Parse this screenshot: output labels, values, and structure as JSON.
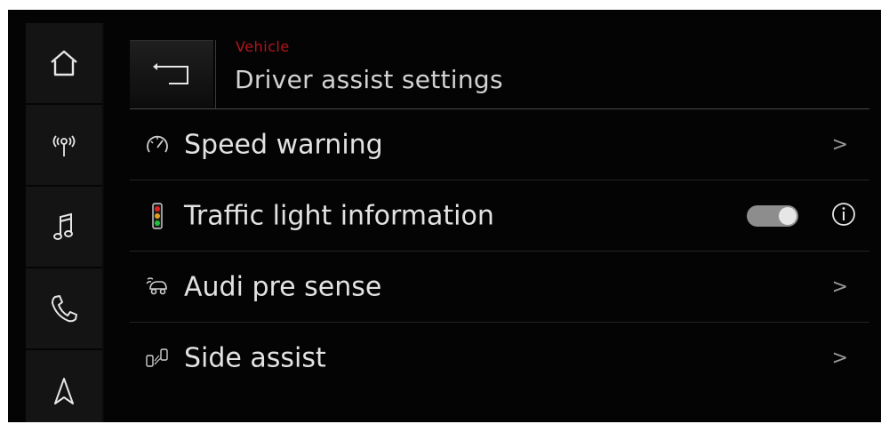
{
  "header": {
    "breadcrumb": "Vehicle",
    "title": "Driver assist settings"
  },
  "sidebar": {
    "items": [
      {
        "icon": "home-icon"
      },
      {
        "icon": "radio-icon"
      },
      {
        "icon": "music-icon"
      },
      {
        "icon": "phone-icon"
      },
      {
        "icon": "navigation-icon"
      }
    ]
  },
  "settings": {
    "items": [
      {
        "label": "Speed warning",
        "icon": "speedometer-icon",
        "control": "chevron",
        "chevron": ">"
      },
      {
        "label": "Traffic light information",
        "icon": "traffic-light-icon",
        "control": "toggle",
        "toggle_on": true
      },
      {
        "label": "Audi pre sense",
        "icon": "pre-sense-icon",
        "control": "chevron",
        "chevron": ">"
      },
      {
        "label": "Side assist",
        "icon": "side-assist-icon",
        "control": "chevron",
        "chevron": ">"
      }
    ]
  },
  "colors": {
    "accent": "#b4161b",
    "background": "#040404",
    "text": "#e2e2e2",
    "toggle_track": "#8d8d8d"
  }
}
